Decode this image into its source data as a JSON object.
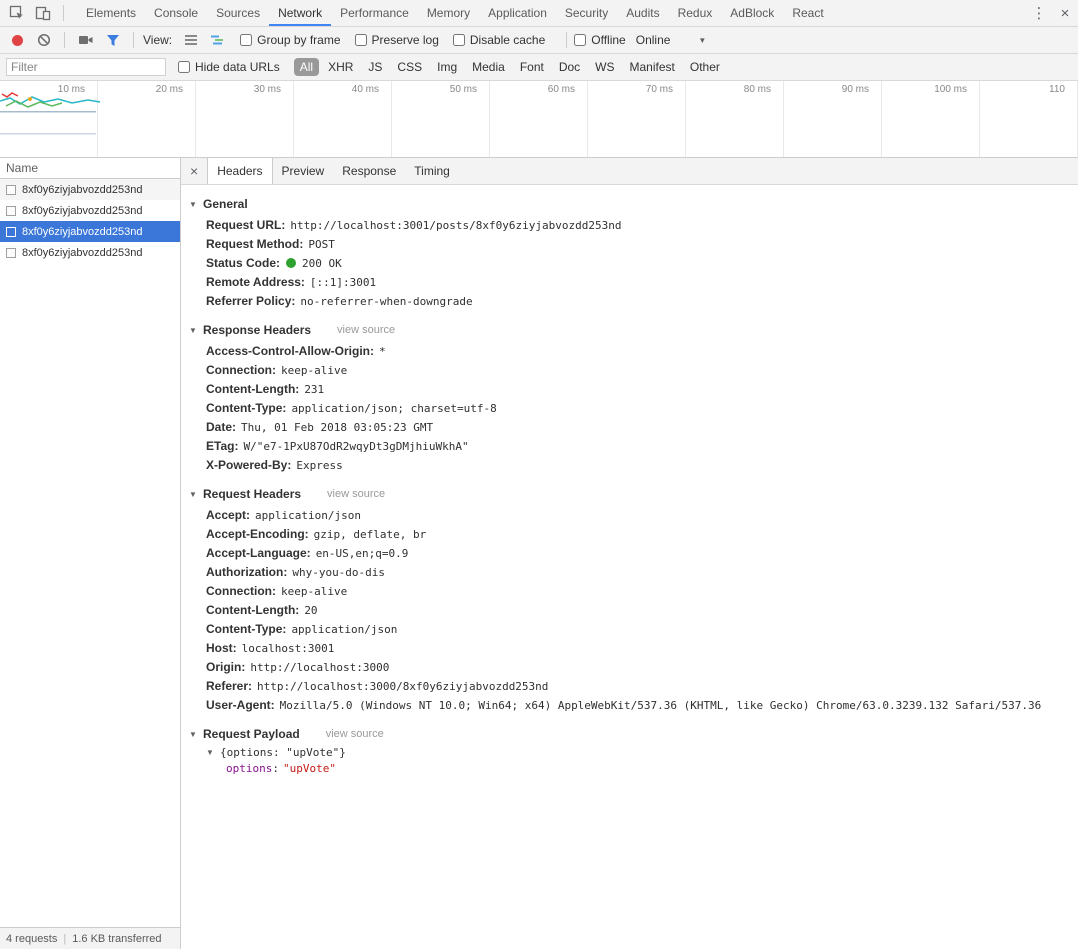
{
  "icons": {
    "menu": "⋮",
    "close": "×",
    "caret": "▼",
    "disclosure": "▼",
    "detail_close": "×"
  },
  "tabs": {
    "items": [
      {
        "label": "Elements",
        "active": false
      },
      {
        "label": "Console",
        "active": false
      },
      {
        "label": "Sources",
        "active": false
      },
      {
        "label": "Network",
        "active": true
      },
      {
        "label": "Performance",
        "active": false
      },
      {
        "label": "Memory",
        "active": false
      },
      {
        "label": "Application",
        "active": false
      },
      {
        "label": "Security",
        "active": false
      },
      {
        "label": "Audits",
        "active": false
      },
      {
        "label": "Redux",
        "active": false
      },
      {
        "label": "AdBlock",
        "active": false
      },
      {
        "label": "React",
        "active": false
      }
    ]
  },
  "toolbar": {
    "view_label": "View:",
    "group_by_frame": "Group by frame",
    "preserve_log": "Preserve log",
    "disable_cache": "Disable cache",
    "offline": "Offline",
    "throttling_value": "Online"
  },
  "filter_bar": {
    "filter_placeholder": "Filter",
    "hide_data_urls_label": "Hide data URLs",
    "types": [
      {
        "label": "All",
        "active": true
      },
      {
        "label": "XHR",
        "active": false
      },
      {
        "label": "JS",
        "active": false
      },
      {
        "label": "CSS",
        "active": false
      },
      {
        "label": "Img",
        "active": false
      },
      {
        "label": "Media",
        "active": false
      },
      {
        "label": "Font",
        "active": false
      },
      {
        "label": "Doc",
        "active": false
      },
      {
        "label": "WS",
        "active": false
      },
      {
        "label": "Manifest",
        "active": false
      },
      {
        "label": "Other",
        "active": false
      }
    ]
  },
  "overview": {
    "ticks": [
      "10 ms",
      "20 ms",
      "30 ms",
      "40 ms",
      "50 ms",
      "60 ms",
      "70 ms",
      "80 ms",
      "90 ms",
      "100 ms",
      "110"
    ]
  },
  "requests": {
    "name_header": "Name",
    "rows": [
      {
        "name": "8xf0y6ziyjabvozdd253nd",
        "selected": false
      },
      {
        "name": "8xf0y6ziyjabvozdd253nd",
        "selected": false
      },
      {
        "name": "8xf0y6ziyjabvozdd253nd",
        "selected": true
      },
      {
        "name": "8xf0y6ziyjabvozdd253nd",
        "selected": false
      }
    ]
  },
  "detail": {
    "tabs": [
      {
        "label": "Headers",
        "active": true
      },
      {
        "label": "Preview",
        "active": false
      },
      {
        "label": "Response",
        "active": false
      },
      {
        "label": "Timing",
        "active": false
      }
    ],
    "general": {
      "title": "General",
      "items": [
        {
          "name": "Request URL:",
          "value": "http://localhost:3001/posts/8xf0y6ziyjabvozdd253nd"
        },
        {
          "name": "Request Method:",
          "value": "POST"
        },
        {
          "name": "Status Code:",
          "value": "200 OK",
          "status_dot": true
        },
        {
          "name": "Remote Address:",
          "value": "[::1]:3001"
        },
        {
          "name": "Referrer Policy:",
          "value": "no-referrer-when-downgrade"
        }
      ]
    },
    "response_headers": {
      "title": "Response Headers",
      "view_source": "view source",
      "items": [
        {
          "name": "Access-Control-Allow-Origin:",
          "value": "*"
        },
        {
          "name": "Connection:",
          "value": "keep-alive"
        },
        {
          "name": "Content-Length:",
          "value": "231"
        },
        {
          "name": "Content-Type:",
          "value": "application/json; charset=utf-8"
        },
        {
          "name": "Date:",
          "value": "Thu, 01 Feb 2018 03:05:23 GMT"
        },
        {
          "name": "ETag:",
          "value": "W/\"e7-1PxU87OdR2wqyDt3gDMjhiuWkhA\""
        },
        {
          "name": "X-Powered-By:",
          "value": "Express"
        }
      ]
    },
    "request_headers": {
      "title": "Request Headers",
      "view_source": "view source",
      "items": [
        {
          "name": "Accept:",
          "value": "application/json"
        },
        {
          "name": "Accept-Encoding:",
          "value": "gzip, deflate, br"
        },
        {
          "name": "Accept-Language:",
          "value": "en-US,en;q=0.9"
        },
        {
          "name": "Authorization:",
          "value": "why-you-do-dis"
        },
        {
          "name": "Connection:",
          "value": "keep-alive"
        },
        {
          "name": "Content-Length:",
          "value": "20"
        },
        {
          "name": "Content-Type:",
          "value": "application/json"
        },
        {
          "name": "Host:",
          "value": "localhost:3001"
        },
        {
          "name": "Origin:",
          "value": "http://localhost:3000"
        },
        {
          "name": "Referer:",
          "value": "http://localhost:3000/8xf0y6ziyjabvozdd253nd"
        },
        {
          "name": "User-Agent:",
          "value": "Mozilla/5.0 (Windows NT 10.0; Win64; x64) AppleWebKit/537.36 (KHTML, like Gecko) Chrome/63.0.3239.132 Safari/537.36"
        }
      ]
    },
    "payload": {
      "title": "Request Payload",
      "view_source": "view source",
      "preview": "{options: \"upVote\"}",
      "key": "options",
      "separator": ":",
      "value": "\"upVote\""
    }
  },
  "status_bar": {
    "requests_count": "4 requests",
    "separator": "|",
    "transferred": "1.6 KB transferred"
  },
  "colors": {
    "accent_blue": "#4285f4",
    "selection_blue": "#3b77d9",
    "status_green": "#2ea22e",
    "json_key": "#881391",
    "json_string": "#c41a16",
    "pill_gray": "#999999"
  }
}
